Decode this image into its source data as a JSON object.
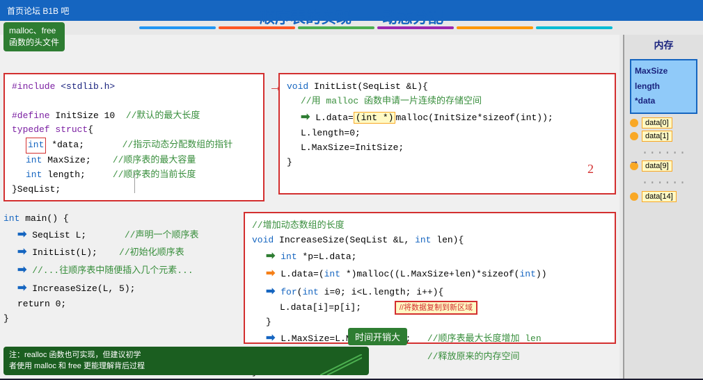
{
  "header": {
    "banner_text": "首页论坛 B1B 吧",
    "title": "顺序表的实现——动态分配"
  },
  "green_annotation": {
    "line1": "malloc、free",
    "line2": "函数的头文件"
  },
  "title_lines_colors": [
    "#2196f3",
    "#ff5722",
    "#4caf50",
    "#9c27b0",
    "#ff9800",
    "#00bcd4"
  ],
  "topleft_box": {
    "lines": [
      "#include <stdlib.h>",
      "",
      "#define InitSize 10  //默认的最大长度",
      "typedef struct{",
      "    int *data;      //指示动态分配数组的指针",
      "    int MaxSize;    //顺序表的最大容量",
      "    int length;     //顺序表的当前长度",
      "}SeqList;"
    ]
  },
  "topright_box": {
    "lines": [
      "void InitList(SeqList &L){",
      "    //用 malloc 函数申请一片连续的存储空间",
      "    L.data=(int *)malloc(InitSize*sizeof(int));",
      "    L.length=0;",
      "    L.MaxSize=InitSize;",
      "}"
    ]
  },
  "bottomleft_area": {
    "lines": [
      "int main() {",
      "    SeqList L;       //声明一个顺序表",
      "    InitList(L);     //初始化顺序表",
      "    //...往顺序表中随便插入几个元素...",
      "    IncreaseSize(L, 5);",
      "    return 0;",
      "}"
    ]
  },
  "bottomright_box": {
    "lines": [
      "//增加动态数组的长度",
      "void IncreaseSize(SeqList &L, int len){",
      "    int *p=L.data;",
      "    L.data=(int *)malloc((L.MaxSize+len)*sizeof(int))",
      "    for(int i=0; i<L.length; i++){",
      "        L.data[i]=p[i];",
      "    }",
      "    L.MaxSize=L.MaxSize+len;  //顺序表最大长度增加 len",
      "    free(p);                  //释放原来的内存空间",
      "}"
    ]
  },
  "bottom_annotation": {
    "text": "注：realloc 函数也可实现，但建议初学\n者使用 malloc 和 free 更能理解背后过程"
  },
  "memory": {
    "title": "内存",
    "struct_fields": [
      "MaxSize",
      "length",
      "*data"
    ],
    "data_items": [
      "data[0]",
      "data[1]",
      "......",
      "data[9]",
      "......",
      "data[14]"
    ]
  },
  "annotations": {
    "copy_data": "//将数据复制到新区域",
    "time_cost": "时间开销大",
    "number_2": "2"
  },
  "arrows": {
    "green": "➡",
    "blue": "➡",
    "yellow": "➡",
    "orange": "➡"
  }
}
